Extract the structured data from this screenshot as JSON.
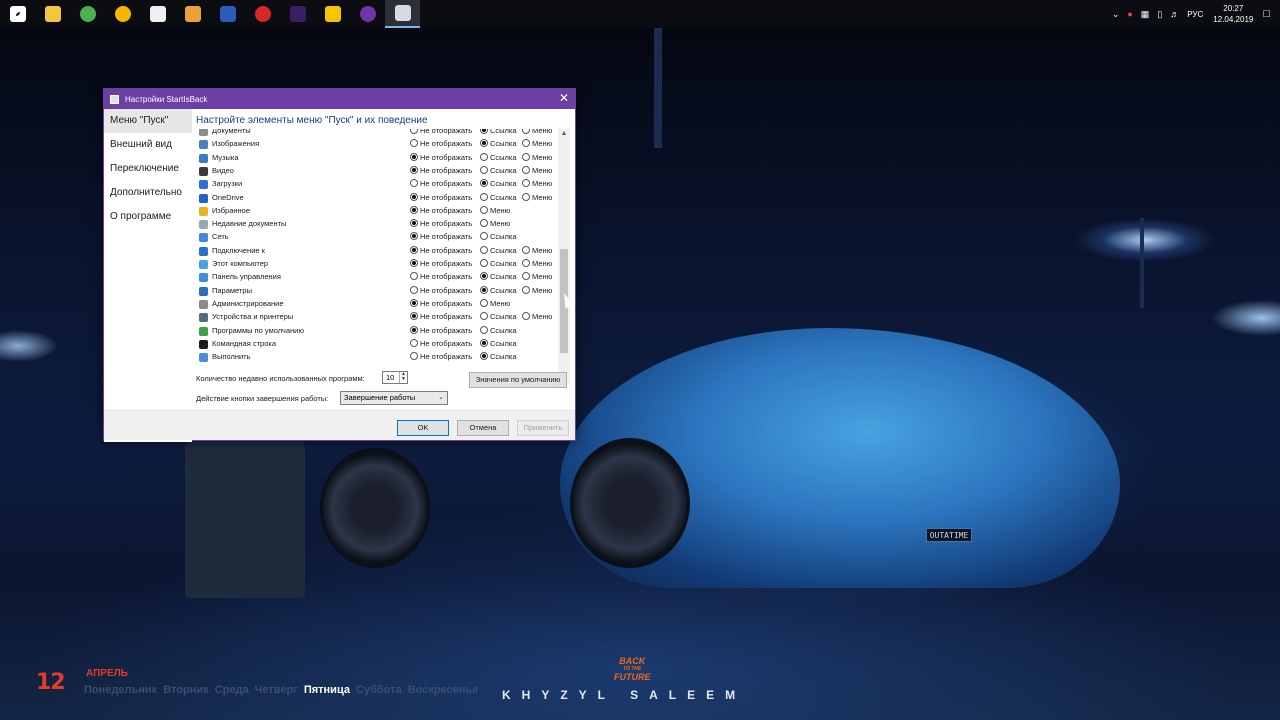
{
  "taskbar": {
    "icons": [
      {
        "name": "windows-start-icon",
        "color": "#ffffff"
      },
      {
        "name": "file-explorer-icon",
        "color": "#f4c542"
      },
      {
        "name": "chrome-icon",
        "color": "#4caf50"
      },
      {
        "name": "yellow-app-icon",
        "color": "#f5b800"
      },
      {
        "name": "store-icon",
        "color": "#f0f0f0"
      },
      {
        "name": "mail-app-icon",
        "color": "#e9a23b"
      },
      {
        "name": "firefox-icon",
        "color": "#2a5dbb"
      },
      {
        "name": "record-app-icon",
        "color": "#d62828"
      },
      {
        "name": "premiere-pro-icon",
        "color": "#3a1f66"
      },
      {
        "name": "warning-app-icon",
        "color": "#f6c500"
      },
      {
        "name": "media-player-icon",
        "color": "#6e36a8"
      },
      {
        "name": "startisback-settings-icon",
        "color": "#d8d8e0"
      }
    ],
    "tray": {
      "lang": "РУС",
      "time": "20:27",
      "date": "12.04.2019"
    }
  },
  "dialog": {
    "title": "Настройки StartIsBack",
    "nav": [
      "Меню \"Пуск\"",
      "Внешний вид",
      "Переключение",
      "Дополнительно",
      "О программе"
    ],
    "heading": "Настройте элементы меню \"Пуск\" и их поведение",
    "option_labels": {
      "hide": "Не отображать",
      "link": "Ссылка",
      "menu": "Меню"
    },
    "rows": [
      {
        "name": "Документы",
        "icon_color": "#8c8c8c",
        "options": [
          "hide",
          "link",
          "menu"
        ],
        "selected": "link"
      },
      {
        "name": "Изображения",
        "icon_color": "#4a7fbf",
        "options": [
          "hide",
          "link",
          "menu"
        ],
        "selected": "link"
      },
      {
        "name": "Музыка",
        "icon_color": "#3a78c8",
        "options": [
          "hide",
          "link",
          "menu"
        ],
        "selected": "hide"
      },
      {
        "name": "Видео",
        "icon_color": "#3c3c3c",
        "options": [
          "hide",
          "link",
          "menu"
        ],
        "selected": "hide"
      },
      {
        "name": "Загрузки",
        "icon_color": "#2f6fd1",
        "options": [
          "hide",
          "link",
          "menu"
        ],
        "selected": "link"
      },
      {
        "name": "OneDrive",
        "icon_color": "#1e63c7",
        "options": [
          "hide",
          "link",
          "menu"
        ],
        "selected": "hide"
      },
      {
        "name": "Избранное",
        "icon_color": "#e6b422",
        "options": [
          "hide",
          "menu"
        ],
        "selected": "hide"
      },
      {
        "name": "Недавние документы",
        "icon_color": "#9aa6b8",
        "options": [
          "hide",
          "menu"
        ],
        "selected": "hide"
      },
      {
        "name": "Сеть",
        "icon_color": "#3c8ad8",
        "options": [
          "hide",
          "link"
        ],
        "selected": "hide"
      },
      {
        "name": "Подключение к",
        "icon_color": "#2d72c9",
        "options": [
          "hide",
          "link",
          "menu"
        ],
        "selected": "hide"
      },
      {
        "name": "Этот компьютер",
        "icon_color": "#4aa0e0",
        "options": [
          "hide",
          "link",
          "menu"
        ],
        "selected": "hide"
      },
      {
        "name": "Панель управления",
        "icon_color": "#3e8fd3",
        "options": [
          "hide",
          "link",
          "menu"
        ],
        "selected": "link"
      },
      {
        "name": "Параметры",
        "icon_color": "#2b6fb8",
        "options": [
          "hide",
          "link",
          "menu"
        ],
        "selected": "link"
      },
      {
        "name": "Администрирование",
        "icon_color": "#8a8a8a",
        "options": [
          "hide",
          "menu"
        ],
        "selected": "hide"
      },
      {
        "name": "Устройства и принтеры",
        "icon_color": "#5a6a7a",
        "options": [
          "hide",
          "link",
          "menu"
        ],
        "selected": "hide"
      },
      {
        "name": "Программы по умолчанию",
        "icon_color": "#3aa24a",
        "options": [
          "hide",
          "link"
        ],
        "selected": "hide"
      },
      {
        "name": "Командная строка",
        "icon_color": "#1c1c1c",
        "options": [
          "hide",
          "link"
        ],
        "selected": "link"
      },
      {
        "name": "Выполнить",
        "icon_color": "#4a8fd8",
        "options": [
          "hide",
          "link"
        ],
        "selected": "link"
      }
    ],
    "recent_label": "Количество недавно использованных программ:",
    "recent_value": "10",
    "defaults_button": "Значения по умолчанию",
    "power_label": "Действие кнопки завершения работы:",
    "power_value": "Завершение работы",
    "ok": "OK",
    "cancel": "Отмена",
    "apply": "Применить"
  },
  "wallpaper": {
    "plate": "OUTATIME",
    "calendar_day": "12",
    "calendar_month": "АПРЕЛЬ",
    "weekdays": [
      "Понедельник",
      "Вторник",
      "Среда",
      "Четверг",
      "Пятница",
      "Суббота",
      "Воскресенье"
    ],
    "today": "Пятница",
    "logo_top": "BACK",
    "logo_mid": "TO THE",
    "logo_bottom": "FUTURE",
    "signature": "KHYZYL SALEEM"
  }
}
